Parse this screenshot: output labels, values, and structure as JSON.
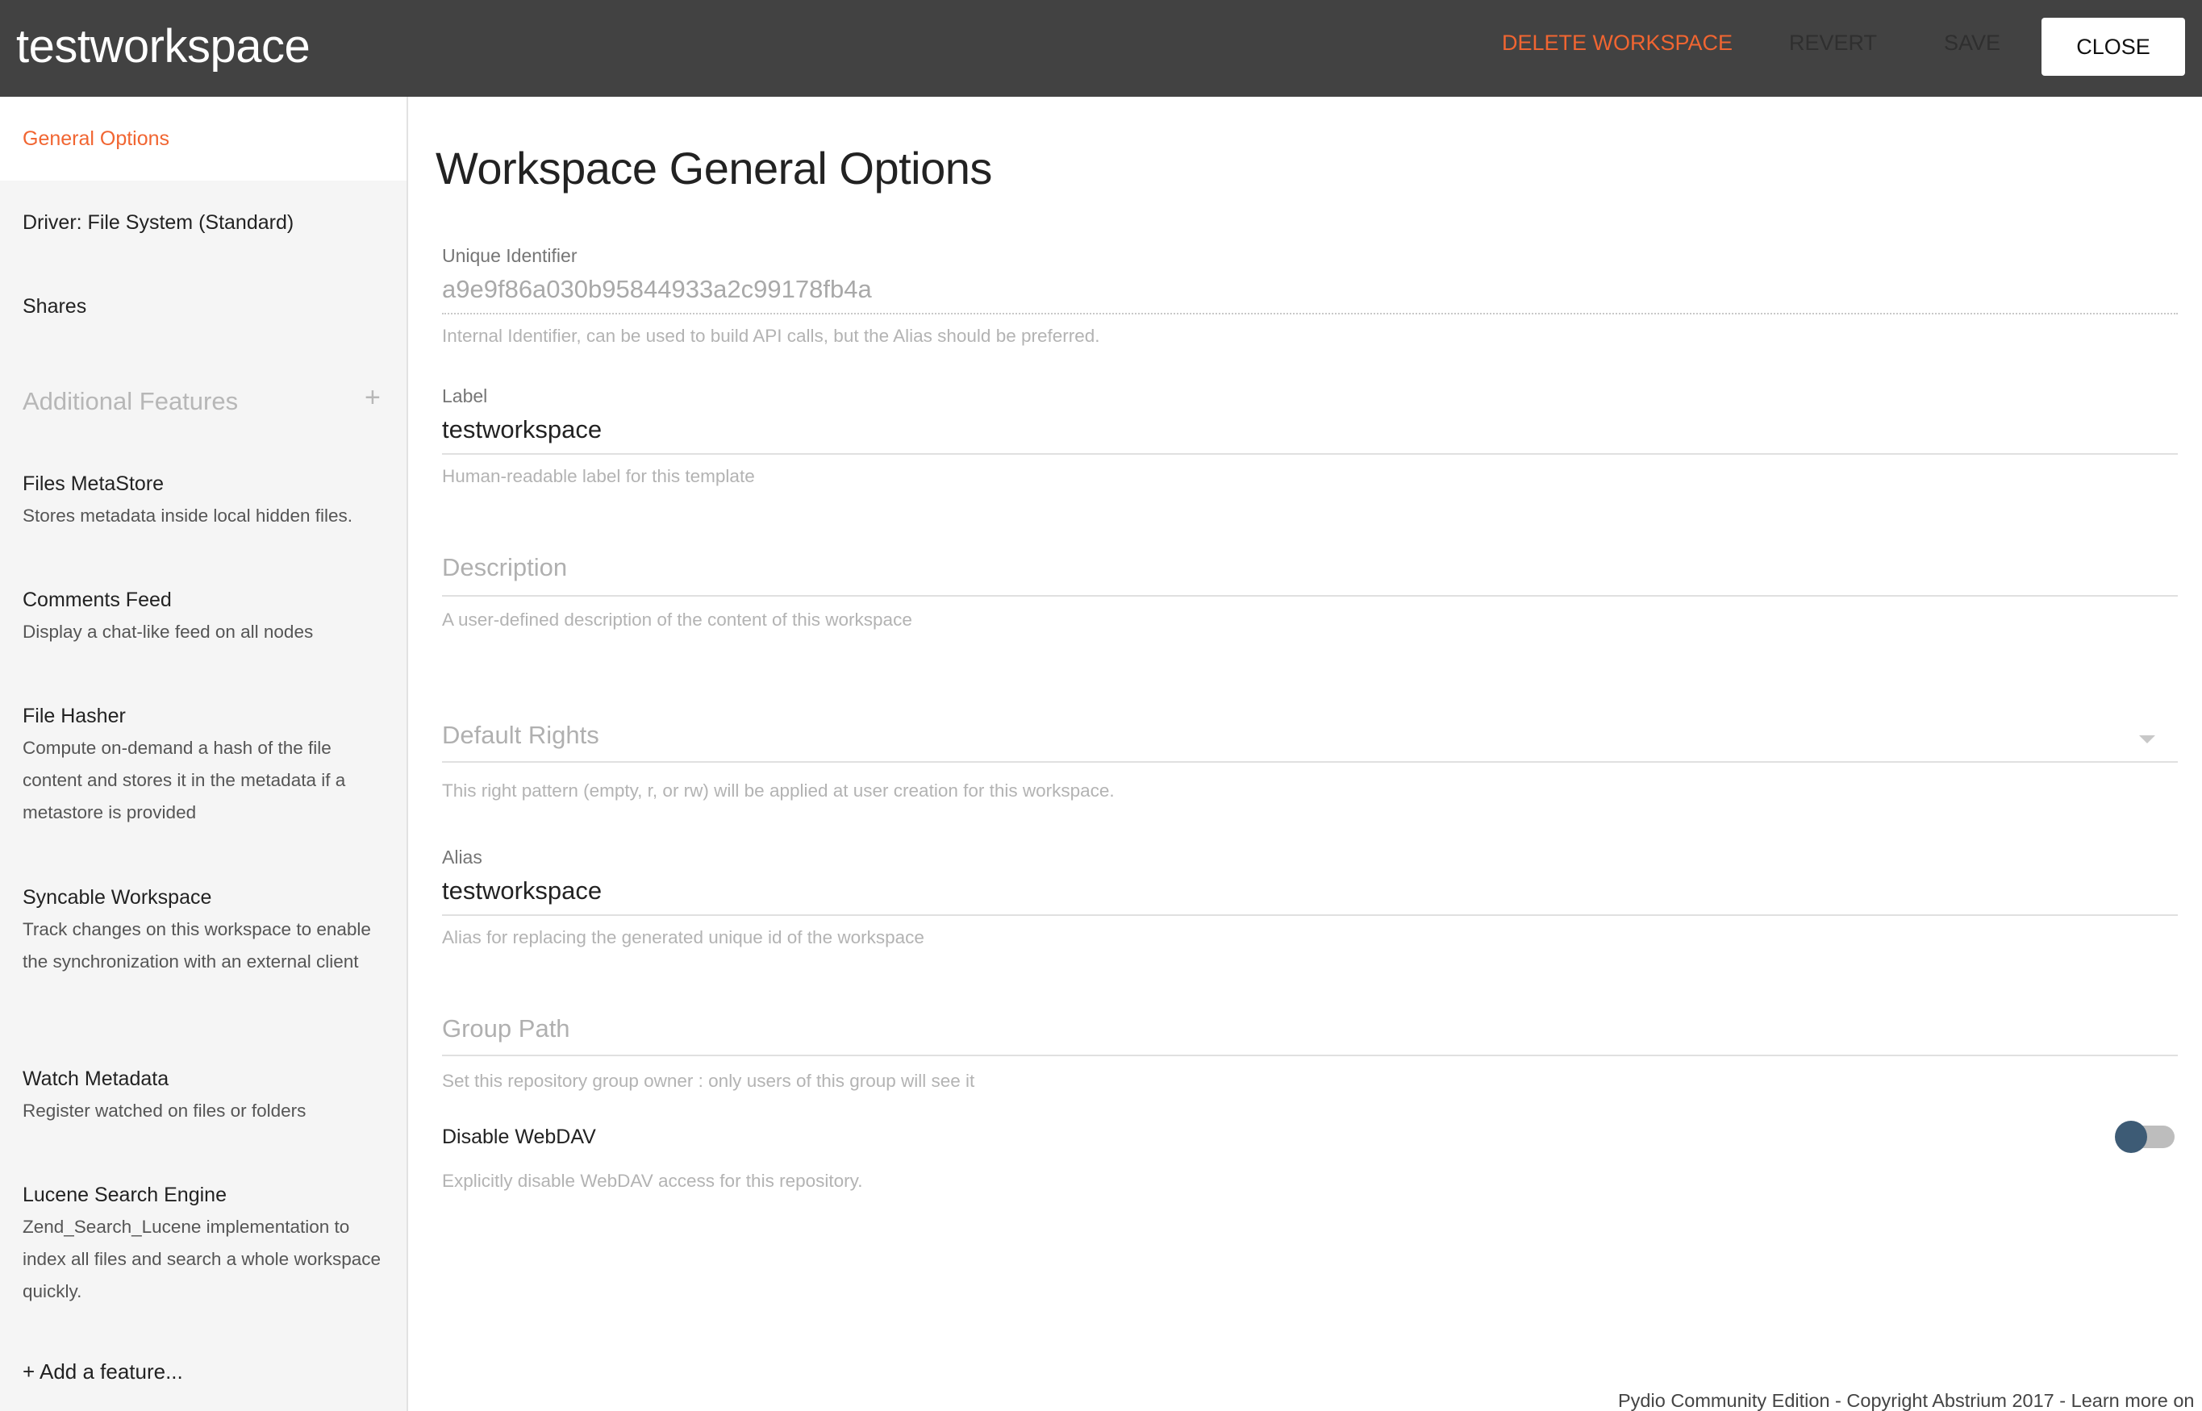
{
  "header": {
    "title": "testworkspace",
    "delete_label": "DELETE WORKSPACE",
    "revert_label": "REVERT",
    "save_label": "SAVE",
    "close_label": "CLOSE"
  },
  "sidebar": {
    "items": [
      {
        "label": "General Options"
      },
      {
        "label": "Driver: File System (Standard)"
      },
      {
        "label": "Shares"
      }
    ],
    "section_title": "Additional Features",
    "add_icon": "+",
    "features": [
      {
        "name": "Files MetaStore",
        "desc": "Stores metadata inside local hidden files."
      },
      {
        "name": "Comments Feed",
        "desc": "Display a chat-like feed on all nodes"
      },
      {
        "name": "File Hasher",
        "desc": "Compute on-demand a hash of the file content and stores it in the metadata if a metastore is provided"
      },
      {
        "name": "Syncable Workspace",
        "desc": "Track changes on this workspace to enable the synchronization with an external client"
      },
      {
        "name": "Watch Metadata",
        "desc": "Register watched on files or folders"
      },
      {
        "name": "Lucene Search Engine",
        "desc": "Zend_Search_Lucene implementation to index all files and search a whole workspace quickly."
      }
    ],
    "add_feature_label": "+ Add a feature..."
  },
  "main": {
    "title": "Workspace General Options",
    "unique_id": {
      "label": "Unique Identifier",
      "value": "a9e9f86a030b95844933a2c99178fb4a",
      "help": "Internal Identifier, can be used to build API calls, but the Alias should be preferred."
    },
    "label_field": {
      "label": "Label",
      "value": "testworkspace",
      "help": "Human-readable label for this template"
    },
    "description": {
      "placeholder": "Description",
      "help": "A user-defined description of the content of this workspace"
    },
    "default_rights": {
      "placeholder": "Default Rights",
      "help": "This right pattern (empty, r, or rw) will be applied at user creation for this workspace."
    },
    "alias": {
      "label": "Alias",
      "value": "testworkspace",
      "help": "Alias for replacing the generated unique id of the workspace"
    },
    "group_path": {
      "placeholder": "Group Path",
      "help": "Set this repository group owner : only users of this group will see it"
    },
    "disable_webdav": {
      "label": "Disable WebDAV",
      "help": "Explicitly disable WebDAV access for this repository.",
      "enabled": false
    }
  },
  "footer": {
    "text": "Pydio Community Edition - Copyright Abstrium 2017 - Learn more on"
  },
  "colors": {
    "accent": "#f16531",
    "header_bg": "#424242",
    "toggle_thumb": "#3d5b75"
  }
}
